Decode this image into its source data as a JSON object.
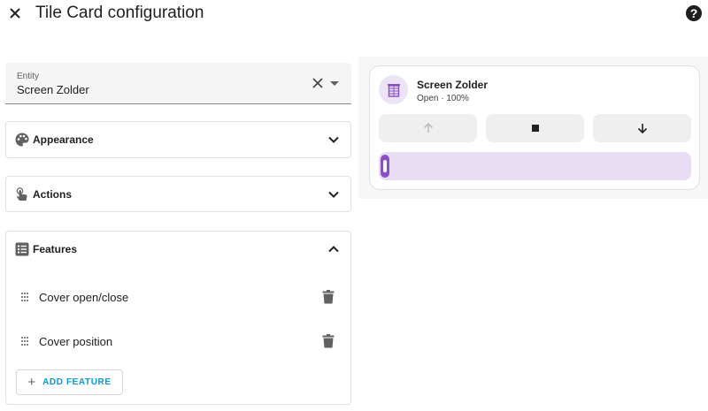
{
  "header": {
    "title": "Tile Card configuration",
    "close_icon": "close-icon",
    "help_icon": "help-circle-icon",
    "help_glyph": "?"
  },
  "entity": {
    "label": "Entity",
    "value": "Screen Zolder"
  },
  "panels": {
    "appearance": {
      "title": "Appearance",
      "icon": "palette-icon",
      "expanded": false
    },
    "actions": {
      "title": "Actions",
      "icon": "gesture-tap-icon",
      "expanded": false
    },
    "features": {
      "title": "Features",
      "icon": "list-box-icon",
      "expanded": true
    }
  },
  "features": {
    "items": [
      {
        "label": "Cover open/close"
      },
      {
        "label": "Cover position"
      }
    ],
    "add_label": "ADD FEATURE",
    "add_glyph": "+"
  },
  "preview": {
    "name": "Screen Zolder",
    "state": "Open · 100%",
    "position_percent": 100,
    "accent": "#8a4fc8",
    "buttons": [
      "arrow-up-icon",
      "stop-icon",
      "arrow-down-icon"
    ]
  }
}
